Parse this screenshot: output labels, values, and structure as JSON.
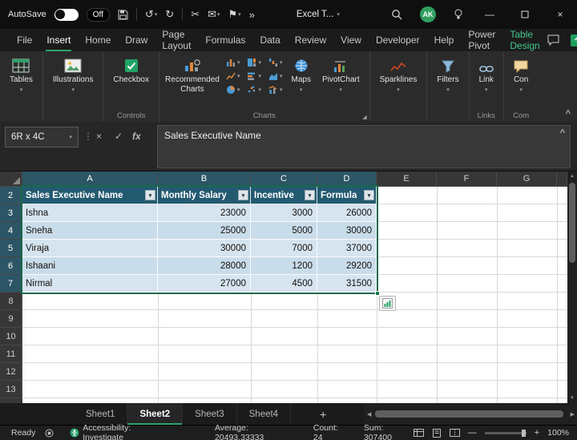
{
  "colors": {
    "accent": "#2ea36b",
    "table_header": "#235a70",
    "selection_fill": "#d6e4ef"
  },
  "icons": {
    "undo": "↺",
    "redo": "↻",
    "cut": "✂",
    "mail": "✉",
    "flag": "⚑",
    "overflow": "»",
    "caret": "▾",
    "close": "×",
    "minimize": "—",
    "menu_dots": "⋮",
    "up": "▲",
    "down": "▼",
    "left": "◀",
    "right": "▶",
    "launcher": "◢",
    "collapse": "^",
    "cancel": "×",
    "enter": "✓",
    "fx": "fx"
  },
  "titlebar": {
    "autosave_label": "AutoSave",
    "autosave_state": "Off",
    "doc_dropdown": "Excel T...",
    "avatar": "AK"
  },
  "ribbon": {
    "tabs": [
      "File",
      "Insert",
      "Home",
      "Draw",
      "Page Layout",
      "Formulas",
      "Data",
      "Review",
      "View",
      "Developer",
      "Help",
      "Power Pivot",
      "Table Design"
    ],
    "active_tab": "Insert",
    "buttons": {
      "tables": "Tables",
      "illustrations": "Illustrations",
      "checkbox": "Checkbox",
      "recommended_charts": "Recommended Charts",
      "maps": "Maps",
      "pivotchart": "PivotChart",
      "sparklines": "Sparklines",
      "filters": "Filters",
      "link": "Link",
      "comments_truncated": "Con"
    },
    "groups": [
      "Controls",
      "Charts",
      "Links",
      "Com"
    ]
  },
  "formula_bar": {
    "name_box": "6R x 4C",
    "formula": "Sales Executive Name"
  },
  "grid": {
    "columns": [
      "A",
      "B",
      "C",
      "D",
      "E",
      "F",
      "G"
    ],
    "rows": [
      "2",
      "3",
      "4",
      "5",
      "6",
      "7",
      "8",
      "9",
      "10",
      "11",
      "12",
      "13"
    ]
  },
  "table": {
    "headers": [
      "Sales Executive Name",
      "Monthly Salary",
      "Incentive",
      "Formula"
    ],
    "rows": [
      [
        "Ishna",
        "23000",
        "3000",
        "26000"
      ],
      [
        "Sneha",
        "25000",
        "5000",
        "30000"
      ],
      [
        "Viraja",
        "30000",
        "7000",
        "37000"
      ],
      [
        "Ishaani",
        "28000",
        "1200",
        "29200"
      ],
      [
        "Nirmal",
        "27000",
        "4500",
        "31500"
      ]
    ]
  },
  "sheets": {
    "tabs": [
      "Sheet1",
      "Sheet2",
      "Sheet3",
      "Sheet4"
    ],
    "active": "Sheet2",
    "add_label": "+"
  },
  "status_bar": {
    "mode": "Ready",
    "accessibility": "Accessibility: Investigate",
    "average": "Average: 20493.33333",
    "count": "Count: 24",
    "sum": "Sum: 307400",
    "zoom": "100%"
  }
}
